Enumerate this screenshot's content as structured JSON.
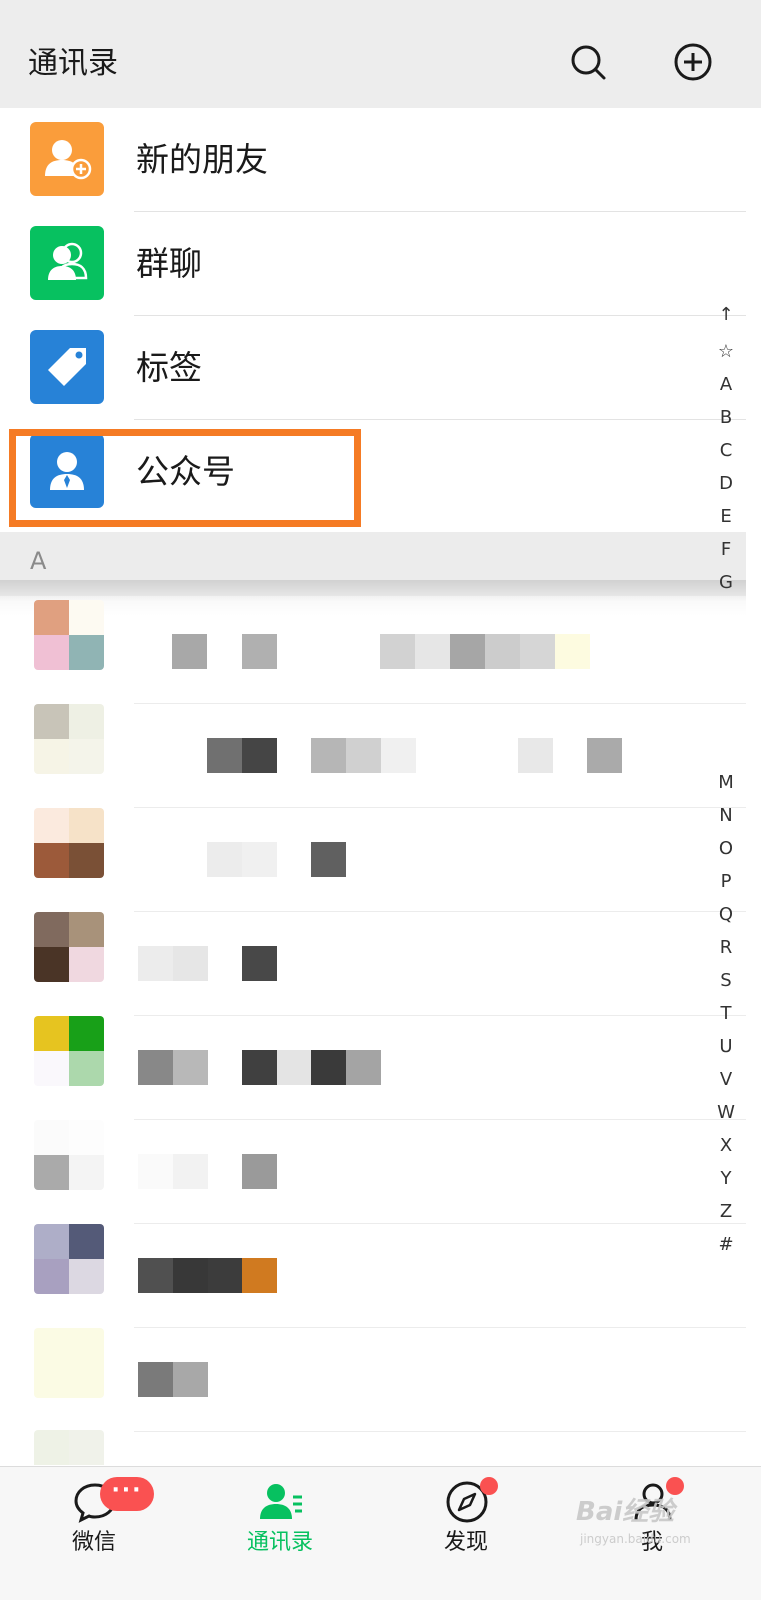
{
  "header": {
    "title": "通讯录",
    "search_icon": "search-icon",
    "add_icon": "plus-circle-icon"
  },
  "menu": [
    {
      "label": "新的朋友",
      "icon": "add-friend-icon",
      "color": "#fa9d3b"
    },
    {
      "label": "群聊",
      "icon": "group-icon",
      "color": "#07c160"
    },
    {
      "label": "标签",
      "icon": "tag-icon",
      "color": "#2782d7"
    },
    {
      "label": "公众号",
      "icon": "official-account-icon",
      "color": "#2782d7"
    }
  ],
  "highlight_color": "#f57b24",
  "section": {
    "letter": "A"
  },
  "index_letters": [
    "↑",
    "☆",
    "A",
    "B",
    "C",
    "D",
    "E",
    "F",
    "G",
    "M",
    "N",
    "O",
    "P",
    "Q",
    "R",
    "S",
    "T",
    "U",
    "V",
    "W",
    "X",
    "Y",
    "Z",
    "#"
  ],
  "tabbar": {
    "tabs": [
      {
        "label": "微信",
        "icon": "chat-bubble-icon",
        "badge": "···"
      },
      {
        "label": "通讯录",
        "icon": "contacts-icon",
        "active": true
      },
      {
        "label": "发现",
        "icon": "compass-icon",
        "dot": true
      },
      {
        "label": "我",
        "icon": "person-icon",
        "dot": true
      }
    ],
    "active_color": "#07c160",
    "badge_color": "#fa5151"
  },
  "watermark": {
    "line1": "Bai经验",
    "line2": "jingyan.baidu.com"
  }
}
